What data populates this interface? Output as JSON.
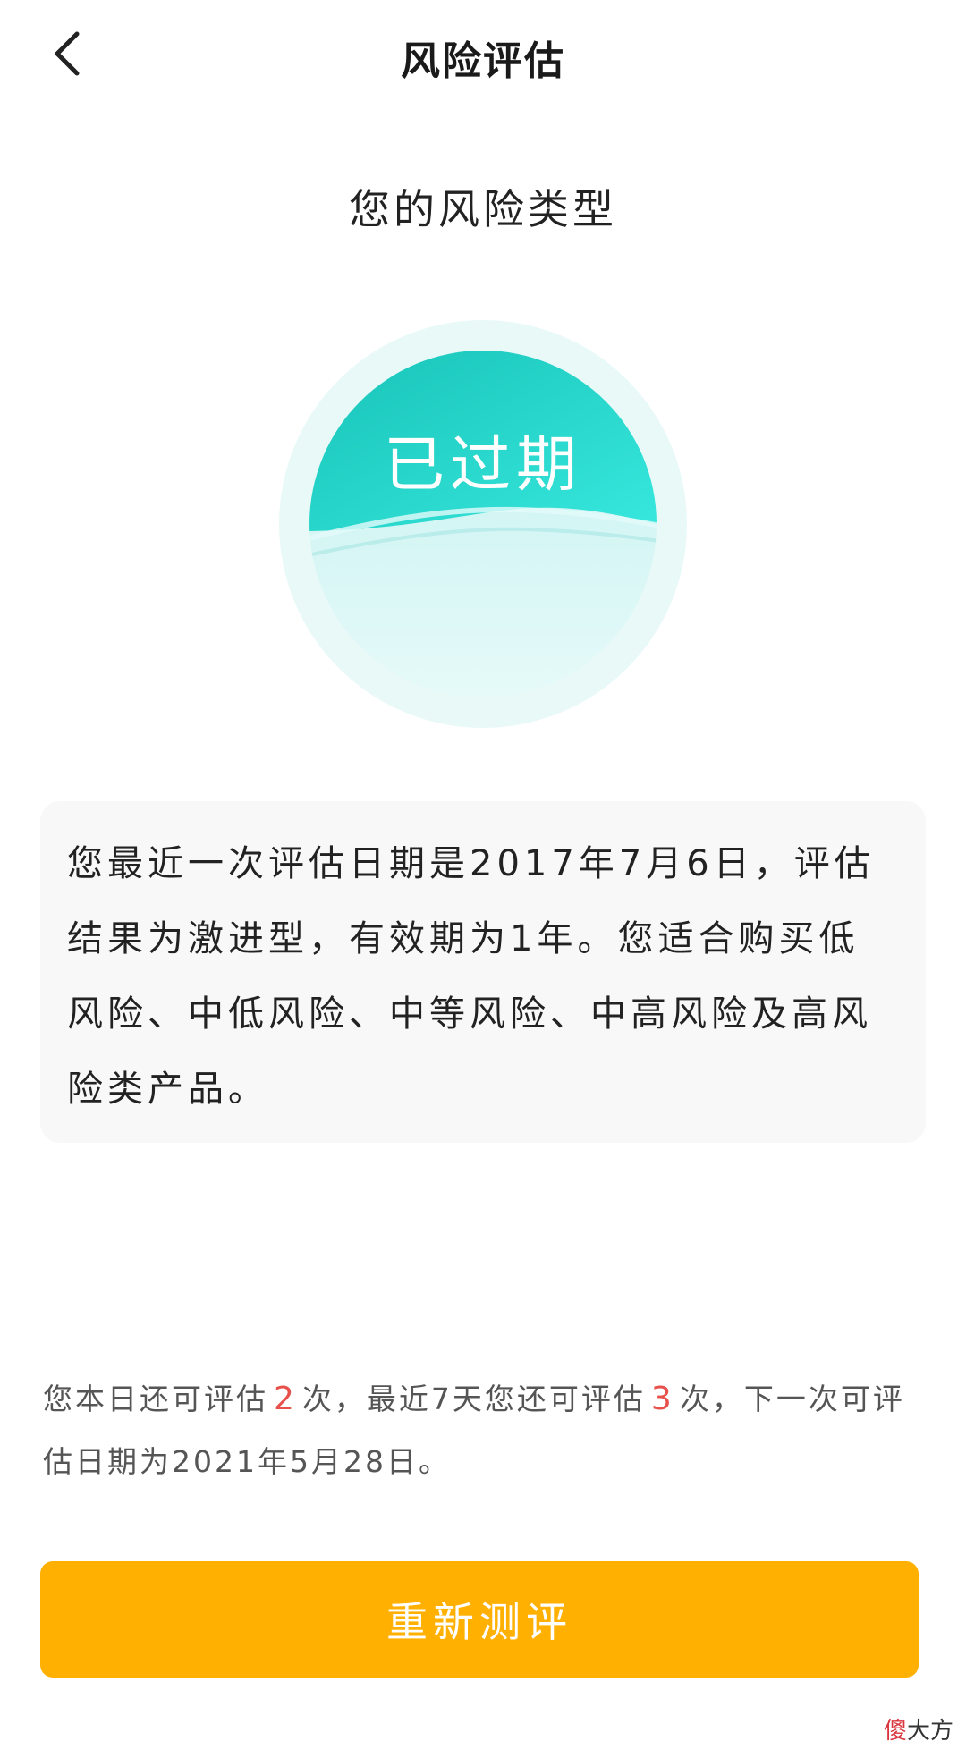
{
  "nav": {
    "title": "风险评估"
  },
  "section_title": "您的风险类型",
  "badge": {
    "label": "已过期",
    "colors": {
      "top": "#1cc9bd",
      "wave": "#c6f1f0",
      "halo": "#e6f9f8"
    }
  },
  "info": {
    "text": "您最近一次评估日期是2017年7月6日，评估结果为激进型，有效期为1年。您适合购买低风险、中低风险、中等风险、中高风险及高风险类产品。"
  },
  "quota": {
    "part1": "您本日还可评估",
    "today_count": "2",
    "part2": "次，最近7天您还可评估",
    "week_count": "3",
    "part3": "次，下一次可评估日期为2021年5月28日。"
  },
  "retest_button": {
    "label": "重新测评",
    "color": "#ffb000"
  },
  "watermark": {
    "part1": "傻",
    "part2": "大方"
  },
  "icons": {
    "back": "chevron-left-icon"
  }
}
